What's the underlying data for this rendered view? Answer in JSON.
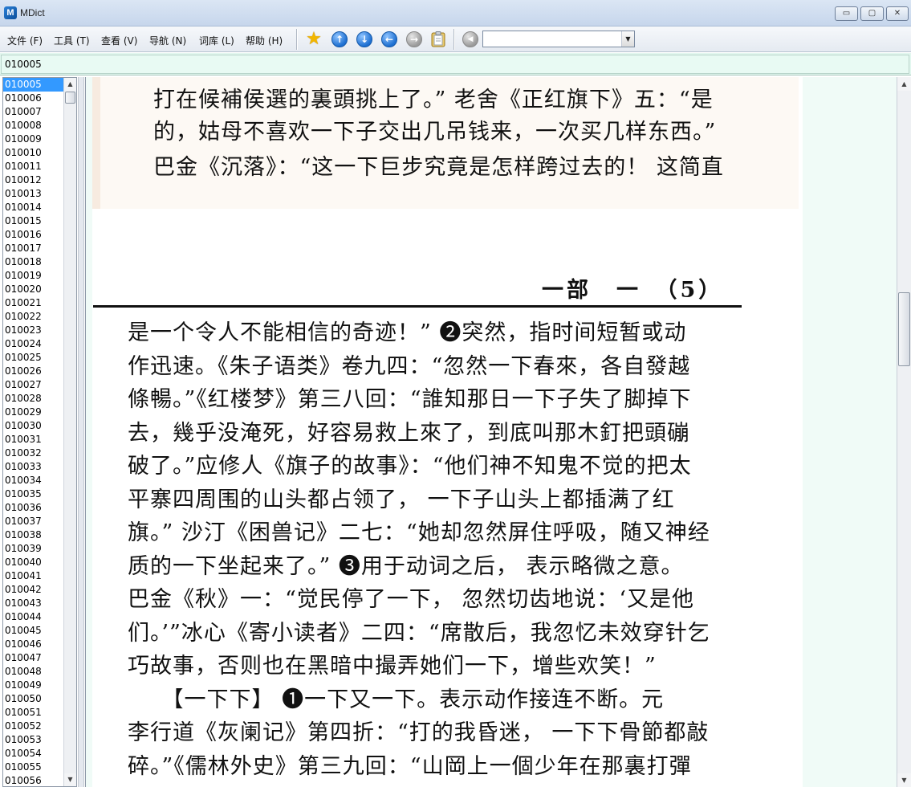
{
  "window": {
    "title": "MDict",
    "app_icon_glyph": "M",
    "min_glyph": "▭",
    "max_glyph": "▢",
    "close_glyph": "✕"
  },
  "menu": {
    "items": [
      {
        "label": "文件 (F)"
      },
      {
        "label": "工具 (T)"
      },
      {
        "label": "查看 (V)"
      },
      {
        "label": "导航 (N)"
      },
      {
        "label": "词库 (L)"
      },
      {
        "label": "帮助 (H)"
      }
    ]
  },
  "toolbar": {
    "icons": [
      "star-icon",
      "arrow-up-icon",
      "arrow-down-icon",
      "arrow-left-icon",
      "arrow-right-icon",
      "clipboard-icon",
      "speaker-icon"
    ],
    "star_glyph": "★",
    "up_glyph": "↑",
    "down_glyph": "↓",
    "left_glyph": "←",
    "right_glyph": "→",
    "clipboard_glyph": "📋",
    "speaker_glyph": "◀",
    "combo_value": "",
    "combo_arrow": "▼"
  },
  "search": {
    "value": "010005"
  },
  "wordlist": {
    "selected_index": 0,
    "items": [
      "010005",
      "010006",
      "010007",
      "010008",
      "010009",
      "010010",
      "010011",
      "010012",
      "010013",
      "010014",
      "010015",
      "010016",
      "010017",
      "010018",
      "010019",
      "010020",
      "010021",
      "010022",
      "010023",
      "010024",
      "010025",
      "010026",
      "010027",
      "010028",
      "010029",
      "010030",
      "010031",
      "010032",
      "010033",
      "010034",
      "010035",
      "010036",
      "010037",
      "010038",
      "010039",
      "010040",
      "010041",
      "010042",
      "010043",
      "010044",
      "010045",
      "010046",
      "010047",
      "010048",
      "010049",
      "010050",
      "010051",
      "010052",
      "010053",
      "010054",
      "010055",
      "010056"
    ],
    "scroll_up": "▲",
    "scroll_down": "▼"
  },
  "content": {
    "top_lines": [
      "打在候補侯選的裏頭挑上了。” 老舍《正红旗下》五：“是",
      "的，姑母不喜欢一下子交出几吊钱来，一次买几样东西。”",
      "巴金《沉落》：“这一下巨步究竟是怎样跨过去的！ 这简直"
    ],
    "page_header": "一部　一　（5）",
    "body_lines": [
      "是一个令人不能相信的奇迹！” ❷突然，指时间短暂或动",
      "作迅速。《朱子语类》卷九四：“忽然一下春來，各自發越",
      "條暢。”《红楼梦》第三八回：“誰知那日一下子失了脚掉下",
      "去，幾乎没淹死，好容易救上來了，到底叫那木釘把頭磞",
      "破了。”应修人《旗子的故事》：“他们神不知鬼不觉的把太",
      "平寨四周围的山头都占领了， 一下子山头上都插满了红",
      "旗。” 沙汀《困兽记》二七：“她却忽然屏住呼吸，随又神经",
      "质的一下坐起来了。” ❸用于动词之后， 表示略微之意。",
      "巴金《秋》一：“觉民停了一下， 忽然切齿地说：‘又是他",
      "们。’”冰心《寄小读者》二四：“席散后，我忽忆未效穿针乞",
      "巧故事，否则也在黑暗中撮弄她们一下，增些欢笑！”",
      "　　【一下下】 ❶一下又一下。表示动作接连不断。元",
      "李行道《灰阑记》第四折：“打的我昏迷， 一下下骨節都敲",
      "碎。”《儒林外史》第三九回：“山岡上一個少年在那裏打彈"
    ]
  },
  "right_scroll": {
    "up": "▲",
    "down": "▼"
  }
}
